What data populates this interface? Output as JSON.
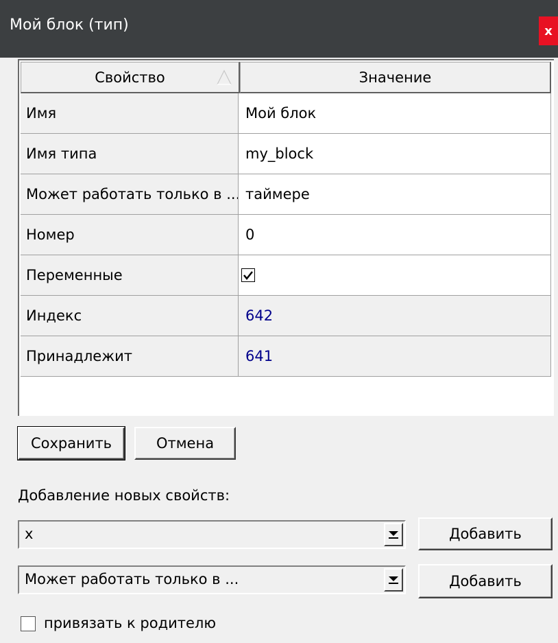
{
  "window": {
    "title": "Мой блок (тип)",
    "close_label": "x"
  },
  "grid": {
    "headers": [
      "Свойство",
      "Значение"
    ],
    "rows": [
      {
        "name": "Имя",
        "value": "Мой блок"
      },
      {
        "name": "Имя типа",
        "value": "my_block"
      },
      {
        "name": "Может работать только в ...",
        "value": "таймере"
      },
      {
        "name": "Номер",
        "value": "0"
      },
      {
        "name": "Переменные",
        "value": "",
        "checked": true
      },
      {
        "name": "Индекс",
        "value": "642",
        "readonly": true
      },
      {
        "name": "Принадлежит",
        "value": "641",
        "readonly": true
      }
    ]
  },
  "actions": {
    "save_label": "Сохранить",
    "cancel_label": "Отмена"
  },
  "add_properties": {
    "label": "Добавление новых свойств:",
    "combo1_value": "x",
    "combo2_value": "Может работать только в ...",
    "add_label": "Добавить"
  },
  "bind_parent": {
    "label": "привязать к родителю",
    "checked": false
  },
  "colors": {
    "title_bg": "#3c3f41",
    "close_bg": "#e81123",
    "readonly_text": "#00008b"
  }
}
